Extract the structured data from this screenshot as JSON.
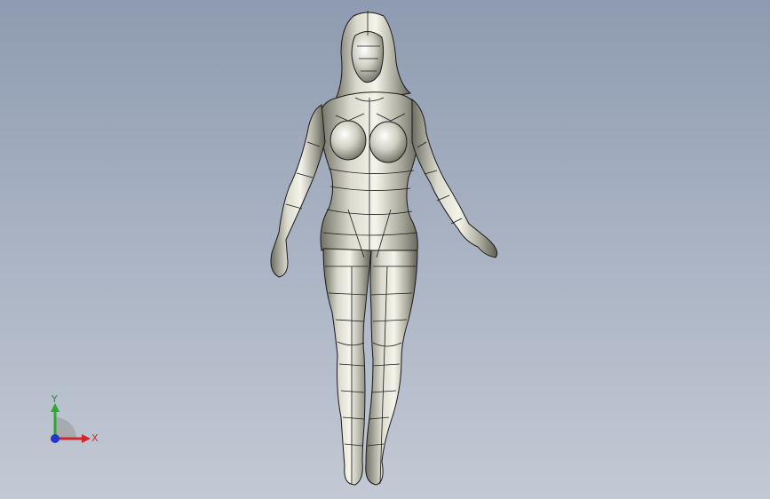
{
  "viewport": {
    "background_top": "#8e9bb0",
    "background_bottom": "#c3c9d4"
  },
  "model": {
    "surface_color": "#bcbcb0",
    "edge_color": "#1a1a1a"
  },
  "triad": {
    "x_label": "X",
    "y_label": "Y",
    "x_color": "#d32626",
    "y_color": "#2ea82e",
    "z_color": "#2337c9"
  }
}
